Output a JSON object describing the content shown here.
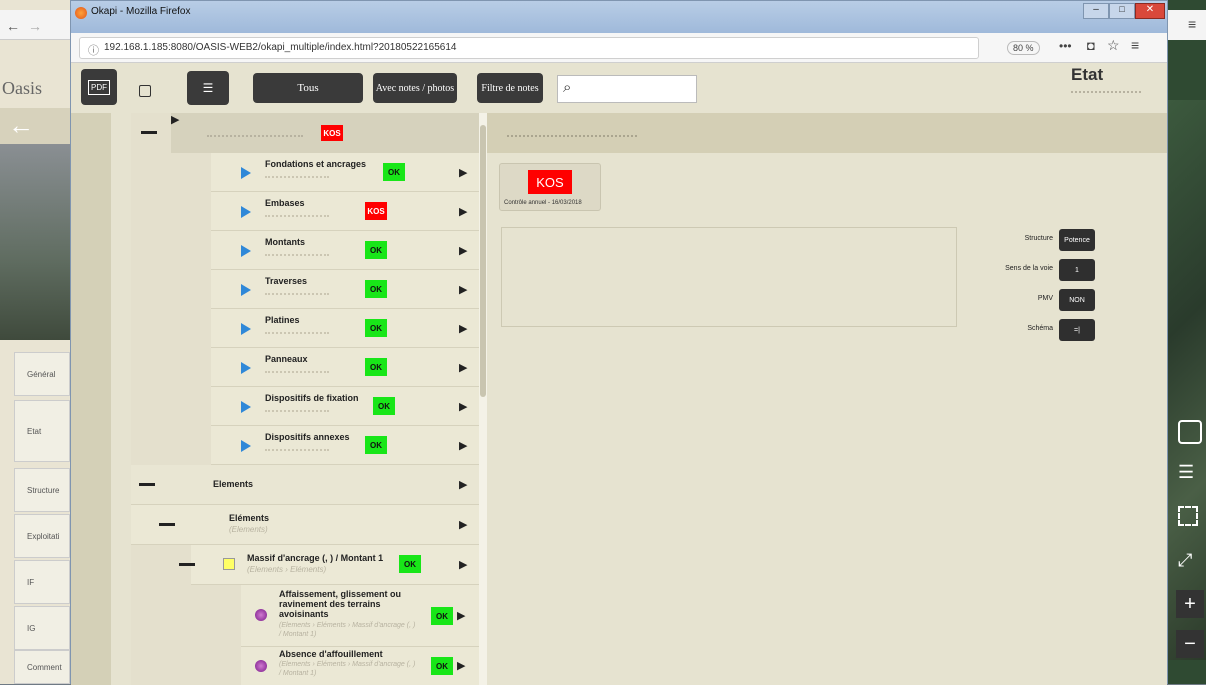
{
  "colors": {
    "accent": "#2f88d8",
    "ok": "#18e618",
    "kos": "#ff0000",
    "dark_button": "#3a3a3a"
  },
  "background_window": {
    "app_title": "Oasis",
    "sidebar_tabs": [
      "Général",
      "Etat",
      "Structure",
      "Exploitati",
      "IF",
      "IG",
      "Comment"
    ]
  },
  "browser": {
    "window_title": "Okapi - Mozilla Firefox",
    "url": "192.168.1.185:8080/OASIS-WEB2/okapi_multiple/index.html?20180522165614",
    "zoom": "80 %",
    "menu_dots": "•••"
  },
  "toolbar": {
    "all_label": "Tous",
    "notes_photos_label": "Avec notes / photos",
    "filter_label": "Filtre de notes",
    "search_value": "",
    "section_title": "Etat"
  },
  "tree": {
    "root": {
      "status": "KOS"
    },
    "children": [
      {
        "title": "Fondations et ancrages",
        "status": "OK"
      },
      {
        "title": "Embases",
        "status": "KOS"
      },
      {
        "title": "Montants",
        "status": "OK"
      },
      {
        "title": "Traverses",
        "status": "OK"
      },
      {
        "title": "Platines",
        "status": "OK"
      },
      {
        "title": "Panneaux",
        "status": "OK"
      },
      {
        "title": "Dispositifs de fixation",
        "status": "OK"
      },
      {
        "title": "Dispositifs annexes",
        "status": "OK"
      }
    ],
    "elements": {
      "title": "Elements"
    },
    "elements_sub": {
      "title": "Eléments",
      "subtitle": "(Elements)"
    },
    "massif": {
      "title": "Massif d'ancrage (, ) / Montant 1",
      "subtitle": "(Elements › Eléments)",
      "status": "OK"
    },
    "leaves": [
      {
        "title": "Affaissement, glissement ou ravinement des terrains avoisinants",
        "subtitle": "(Elements › Eléments › Massif d'ancrage (, ) / Montant 1)",
        "status": "OK"
      },
      {
        "title": "Absence d'affouillement",
        "subtitle": "(Elements › Eléments › Massif d'ancrage (, ) / Montant 1)",
        "status": "OK"
      }
    ]
  },
  "detail": {
    "status_card": {
      "status": "KOS",
      "caption": "Contrôle annuel - 16/03/2018"
    },
    "properties": [
      {
        "label": "Structure",
        "value": "Potence"
      },
      {
        "label": "Sens de la voie",
        "value": "1"
      },
      {
        "label": "PMV",
        "value": "NON"
      },
      {
        "label": "Schéma",
        "value": "=|"
      }
    ]
  }
}
